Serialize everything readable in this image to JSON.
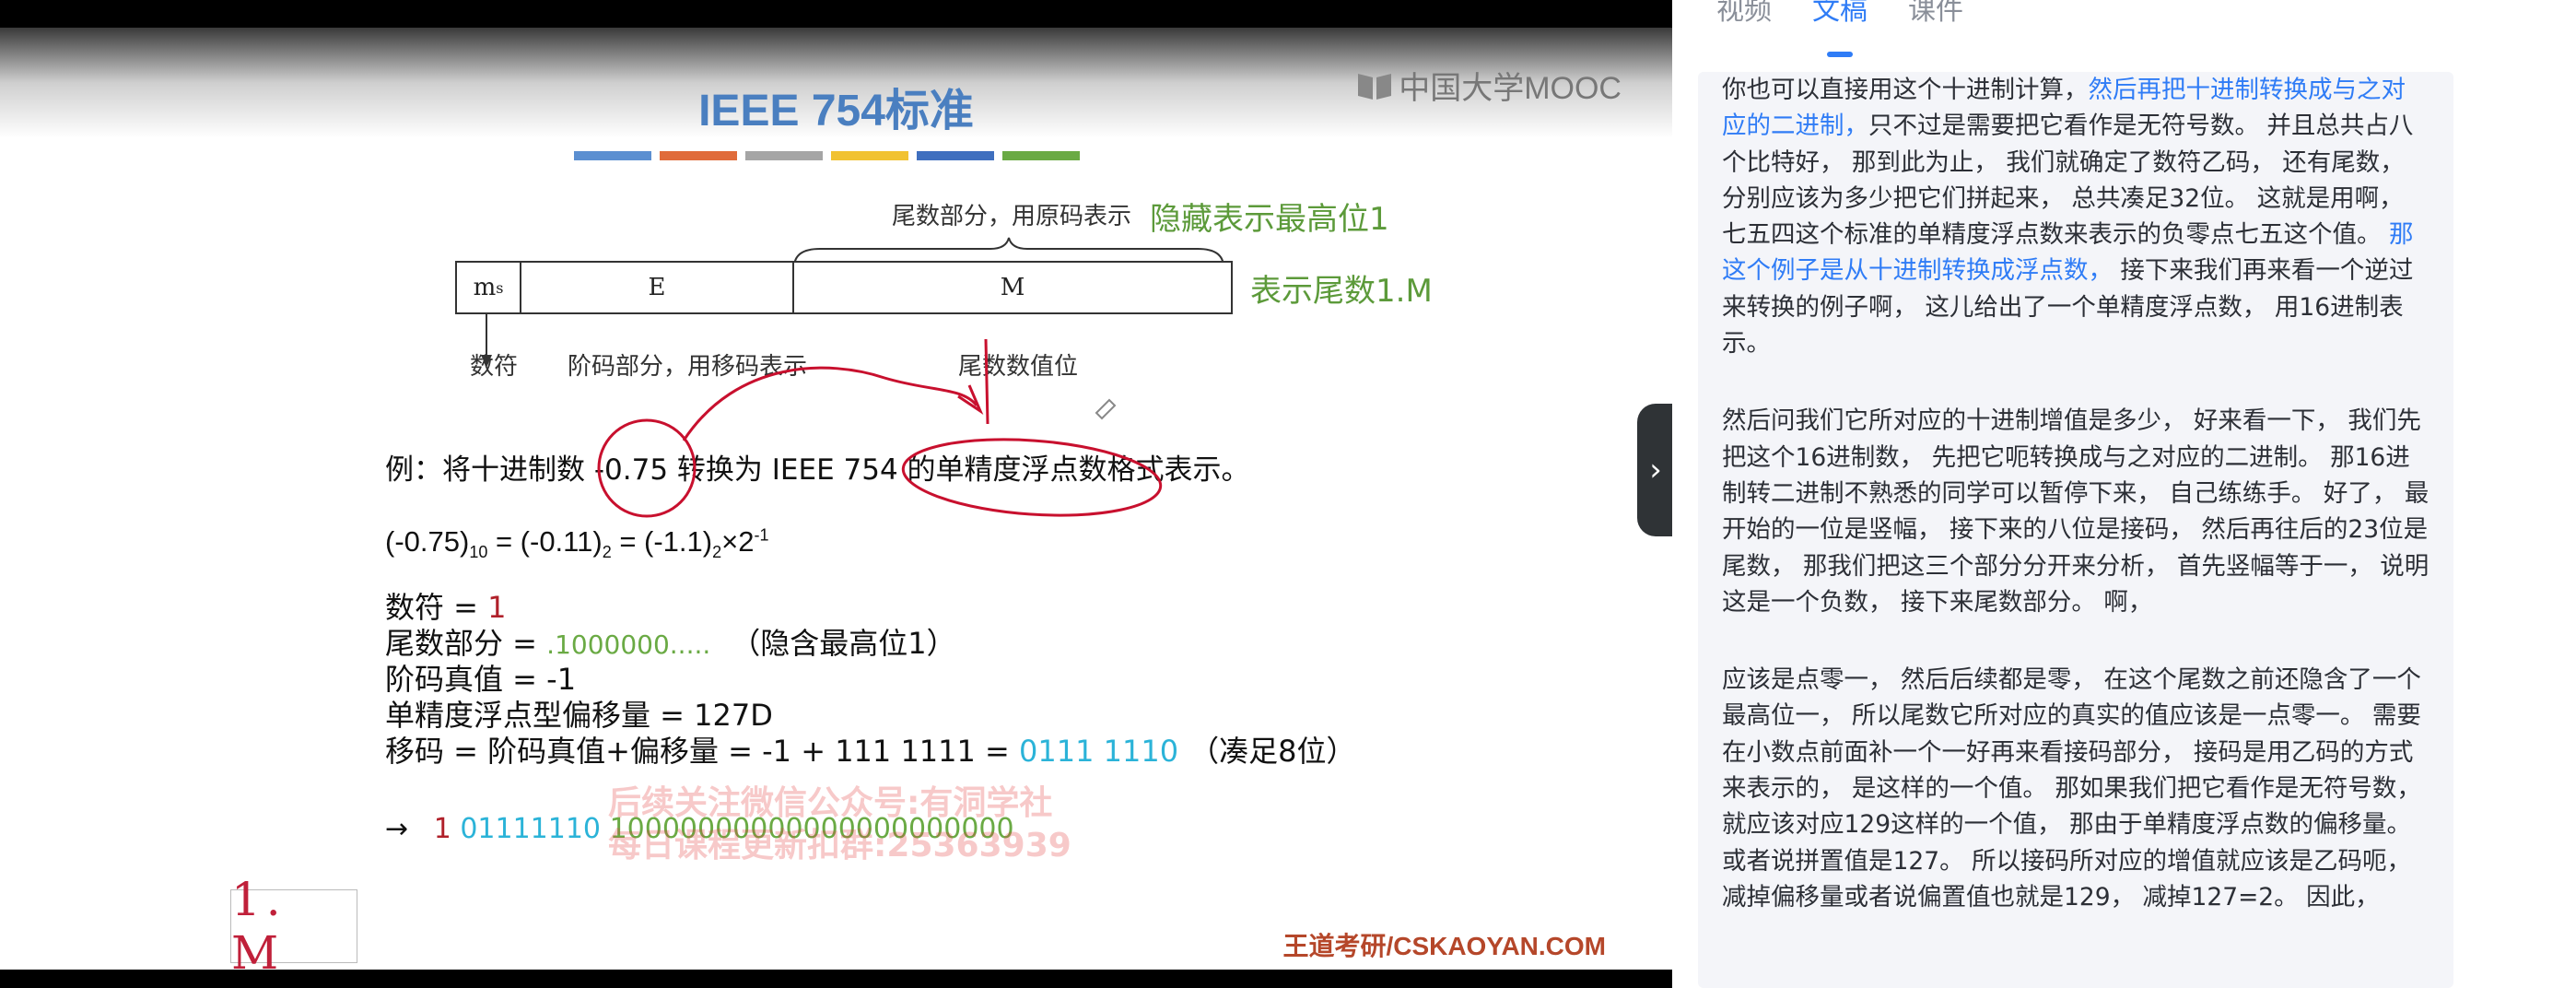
{
  "slide": {
    "title": "IEEE 754标准",
    "logo": "中国大学MOOC",
    "stripe_colors": [
      "#5b8fd1",
      "#e06b3a",
      "#a5a5a5",
      "#f1c232",
      "#3f6fbf",
      "#6aaa44"
    ],
    "diagram": {
      "top_label": "尾数部分，用原码表示",
      "hidden_bit_note": "隐藏表示最高位1",
      "mantissa_note": "表示尾数1.M",
      "ms_cell": "m",
      "ms_sub": "s",
      "e_cell": "E",
      "m_cell": "M",
      "sign_label": "数符",
      "exponent_label": "阶码部分，用移码表示",
      "mantissa_value_label": "尾数数值位"
    },
    "example": "例：将十进制数 -0.75 转换为 IEEE 754 的单精度浮点数格式表示。",
    "formula": {
      "lhs": "(-0.75)",
      "lhs_sub": "10",
      "eq1": " = (-0.11)",
      "sub2": "2",
      "eq2": " = (-1.1)",
      "sub3": "2",
      "times": "×2",
      "exp": "-1"
    },
    "lines": {
      "sign_label": "数符 = ",
      "sign_value": "1",
      "mantissa_label": "尾数部分 = ",
      "mantissa_value": ".1000000.....",
      "mantissa_note": "（隐含最高位1）",
      "exp_true": "阶码真值 = -1",
      "bias": "单精度浮点型偏移量 = 127D",
      "biased_label": "移码 = 阶码真值+偏移量 = -1 + 111 1111 = ",
      "biased_value": "0111 1110",
      "biased_note": "（凑足8位）"
    },
    "result": {
      "arrow": "→",
      "sign": "1",
      "exponent": "01111110",
      "mantissa": "10000000000000000000000"
    },
    "watermark_1": "后续关注微信公众号:有洞学社",
    "watermark_2": "每日课程更新扣群:25363939",
    "handwritten_note": "1. M",
    "footer": "王道考研/CSKAOYAN.COM"
  },
  "panel": {
    "tabs": [
      {
        "label": "视频",
        "active": false
      },
      {
        "label": "文稿",
        "active": true
      },
      {
        "label": "课件",
        "active": false
      }
    ],
    "paragraphs": [
      [
        {
          "t": "你也可以直接用这个十进制计算，",
          "hl": false
        },
        {
          "t": "然后再把十进制转换成与之对应的二进制，",
          "hl": true
        },
        {
          "t": "只不过是需要把它看作是无符号数。 并且总共占八个比特好， 那到此为止， 我们就确定了数符乙码， 还有尾数， 分别应该为多少把它们拼起来， 总共凑足32位。 这就是用啊， 七五四这个标准的单精度浮点数来表示的负零点七五这个值。 ",
          "hl": false
        },
        {
          "t": "那这个例子是从十进制转换成浮点数，",
          "hl": true
        },
        {
          "t": " 接下来我们再来看一个逆过来转换的例子啊， 这儿给出了一个单精度浮点数， 用16进制表示。",
          "hl": false
        }
      ],
      [
        {
          "t": "然后问我们它所对应的十进制增值是多少， 好来看一下， 我们先把这个16进制数， 先把它呃转换成与之对应的二进制。 那16进制转二进制不熟悉的同学可以暂停下来， 自己练练手。 好了， 最开始的一位是竖幅， 接下来的八位是接码， 然后再往后的23位是尾数， 那我们把这三个部分分开来分析， 首先竖幅等于一， 说明这是一个负数， 接下来尾数部分。 啊，",
          "hl": false
        }
      ],
      [
        {
          "t": "应该是点零一， 然后后续都是零， 在这个尾数之前还隐含了一个最高位一， 所以尾数它所对应的真实的值应该是一点零一。 需要在小数点前面补一个一好再来看接码部分， 接码是用乙码的方式来表示的， 是这样的一个值。 那如果我们把它看作是无符号数， 就应该对应129这样的一个值， 那由于单精度浮点数的偏移量。 或者说拼置值是127。 所以接码所对应的增值就应该是乙码呃， 减掉偏移量或者说偏置值也就是129， 减掉127=2。 因此，",
          "hl": false
        }
      ]
    ]
  }
}
